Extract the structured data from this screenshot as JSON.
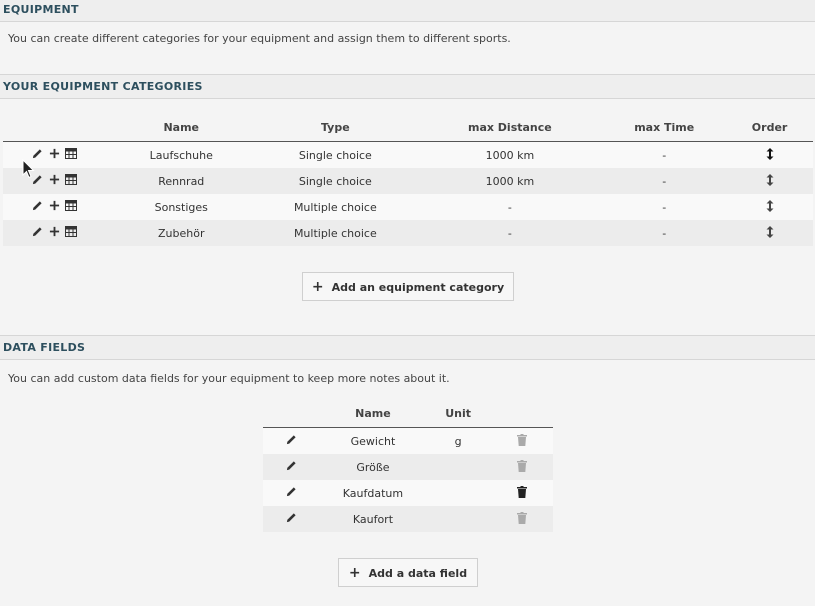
{
  "equipment": {
    "title": "EQUIPMENT",
    "description": "You can create different categories for your equipment and assign them to different sports."
  },
  "categories": {
    "title": "YOUR EQUIPMENT CATEGORIES",
    "headers": {
      "name": "Name",
      "type": "Type",
      "max_distance": "max Distance",
      "max_time": "max Time",
      "order": "Order"
    },
    "rows": [
      {
        "name": "Laufschuhe",
        "type": "Single choice",
        "max_distance": "1000 km",
        "max_time": "-"
      },
      {
        "name": "Rennrad",
        "type": "Single choice",
        "max_distance": "1000 km",
        "max_time": "-"
      },
      {
        "name": "Sonstiges",
        "type": "Multiple choice",
        "max_distance": "-",
        "max_time": "-"
      },
      {
        "name": "Zubehör",
        "type": "Multiple choice",
        "max_distance": "-",
        "max_time": "-"
      }
    ],
    "add_button": "Add an equipment category"
  },
  "data_fields": {
    "title": "DATA FIELDS",
    "description": "You can add custom data fields for your equipment to keep more notes about it.",
    "headers": {
      "name": "Name",
      "unit": "Unit"
    },
    "rows": [
      {
        "name": "Gewicht",
        "unit": "g"
      },
      {
        "name": "Größe",
        "unit": ""
      },
      {
        "name": "Kaufdatum",
        "unit": ""
      },
      {
        "name": "Kaufort",
        "unit": ""
      }
    ],
    "add_button": "Add a data field"
  },
  "icons": {
    "edit": "pencil-icon",
    "add": "plus-icon",
    "table": "table-icon",
    "order": "sort-arrows-icon",
    "delete": "trash-icon"
  },
  "colors": {
    "header_text": "#2d4f5e",
    "header_bg": "#eeeeee"
  }
}
